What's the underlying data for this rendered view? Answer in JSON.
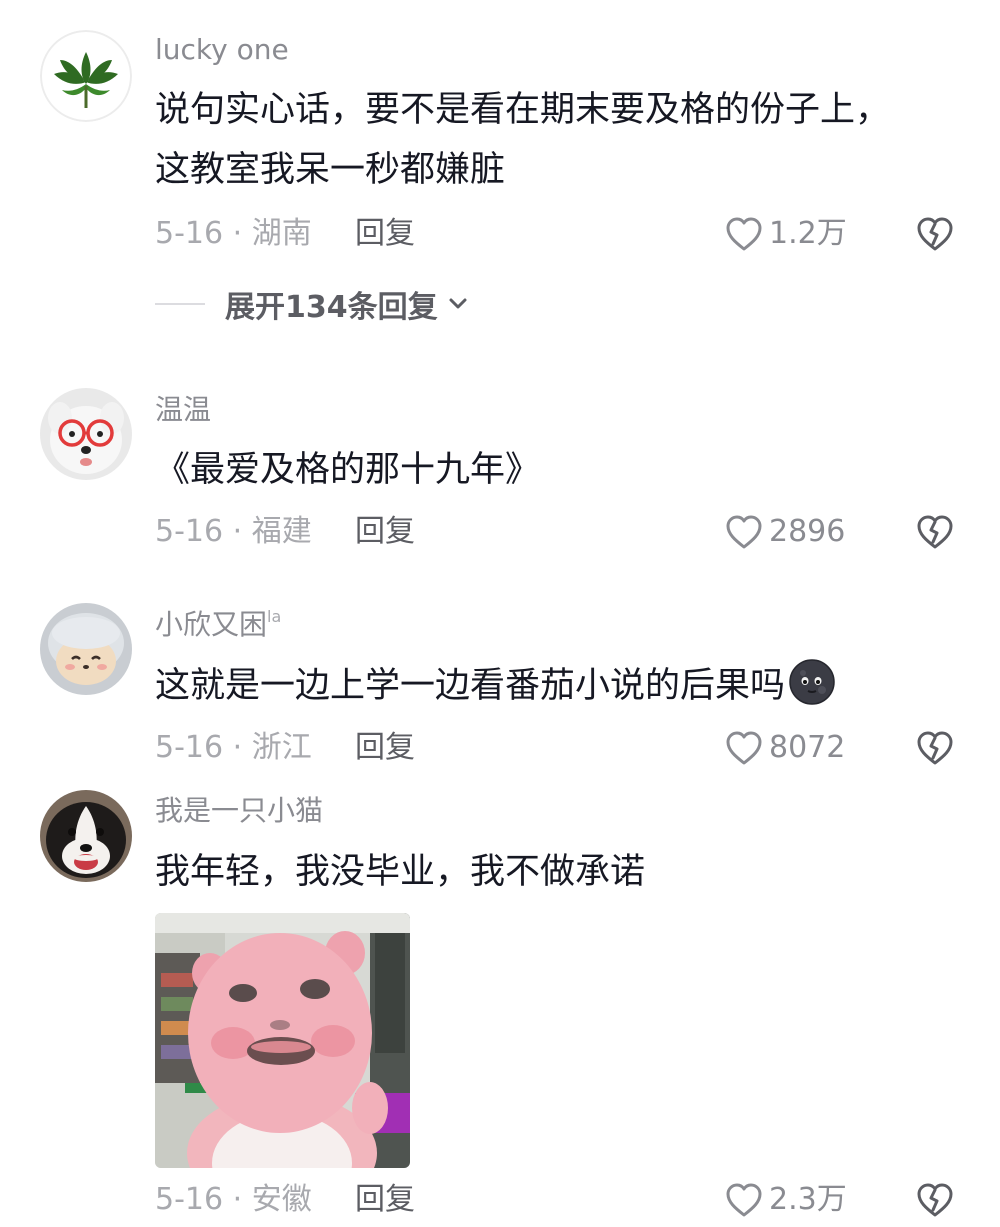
{
  "comments": [
    {
      "username": "lucky one",
      "text_lines": [
        "说句实心话，要不是看在期末要及格的份子上，",
        "这教室我呆一秒都嫌脏"
      ],
      "date_location": "5-16 · 湖南",
      "reply_label": "回复",
      "likes": "1.2万",
      "expand_replies": "展开134条回复"
    },
    {
      "username": "温温",
      "text": "《最爱及格的那十九年》",
      "date_location": "5-16 · 福建",
      "reply_label": "回复",
      "likes": "2896"
    },
    {
      "username": "小欣又困",
      "username_suffix": "la",
      "text": "这就是一边上学一边看番茄小说的后果吗",
      "date_location": "5-16 · 浙江",
      "reply_label": "回复",
      "likes": "8072"
    },
    {
      "username": "我是一只小猫",
      "text": "我年轻，我没毕业，我不做承诺",
      "date_location": "5-16 · 安徽",
      "reply_label": "回复",
      "likes": "2.3万"
    }
  ],
  "icons": {
    "like": "heart-outline-icon",
    "dislike": "broken-heart-icon",
    "expand": "chevron-down-icon",
    "emoji": "dark-moon-face-emoji"
  },
  "colors": {
    "text_primary": "#161823",
    "text_secondary": "#8a8b91",
    "text_tertiary": "#a8a9ae",
    "reply_text": "#5c5d63"
  }
}
